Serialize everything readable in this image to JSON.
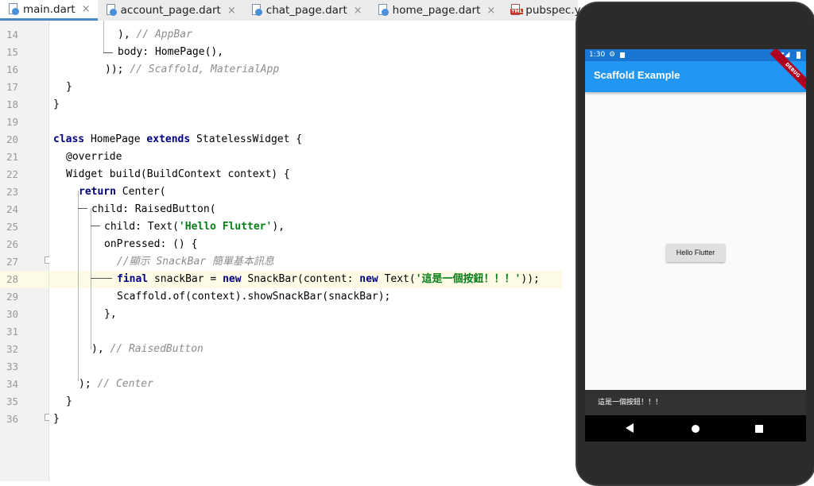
{
  "tabs": [
    {
      "label": "main.dart",
      "icon": "dart-file-icon",
      "active": true
    },
    {
      "label": "account_page.dart",
      "icon": "dart-file-icon",
      "active": false
    },
    {
      "label": "chat_page.dart",
      "icon": "dart-file-icon",
      "active": false
    },
    {
      "label": "home_page.dart",
      "icon": "dart-file-icon",
      "active": false
    },
    {
      "label": "pubspec.yaml",
      "icon": "yaml-file-icon",
      "active": false
    }
  ],
  "close_glyph": "×",
  "editor": {
    "highlight_line": "28",
    "lines": [
      {
        "num": "14"
      },
      {
        "num": "15"
      },
      {
        "num": "16"
      },
      {
        "num": "17"
      },
      {
        "num": "18"
      },
      {
        "num": "19"
      },
      {
        "num": "20"
      },
      {
        "num": "21"
      },
      {
        "num": "22"
      },
      {
        "num": "23"
      },
      {
        "num": "24"
      },
      {
        "num": "25"
      },
      {
        "num": "26"
      },
      {
        "num": "27"
      },
      {
        "num": "28"
      },
      {
        "num": "29"
      },
      {
        "num": "30"
      },
      {
        "num": "31"
      },
      {
        "num": "32"
      },
      {
        "num": "33"
      },
      {
        "num": "34"
      },
      {
        "num": "35"
      },
      {
        "num": "36"
      }
    ],
    "tokens": {
      "l14_a": "), ",
      "l14_c": "// AppBar",
      "l15_a": "body: HomePage(),",
      "l16_a": ")); ",
      "l16_c": "// Scaffold, MaterialApp",
      "l17_a": "}",
      "l18_a": "}",
      "l20_k1": "class",
      "l20_a": " HomePage ",
      "l20_k2": "extends",
      "l20_b": " StatelessWidget {",
      "l21_a": "@override",
      "l22_a": "Widget build(BuildContext context) {",
      "l23_k": "return",
      "l23_a": " Center(",
      "l24_a": "child: RaisedButton(",
      "l25_a": "child: Text(",
      "l25_s": "'Hello Flutter'",
      "l25_b": "),",
      "l26_a": "onPressed: () {",
      "l27_c": "//顯示 SnackBar 簡單基本訊息",
      "l28_k1": "final",
      "l28_a": " snackBar = ",
      "l28_k2": "new",
      "l28_b": " SnackBar(content: ",
      "l28_k3": "new",
      "l28_c": " Text(",
      "l28_s": "'這是一個按鈕！！！'",
      "l28_d": "));",
      "l29_a": "Scaffold.of(context).showSnackBar(snackBar);",
      "l30_a": "},",
      "l32_a": "), ",
      "l32_c": "// RaisedButton",
      "l34_a": "); ",
      "l34_c": "// Center",
      "l35_a": "}",
      "l36_a": "}"
    }
  },
  "phone": {
    "status_time": "1:30",
    "appbar_title": "Scaffold Example",
    "debug_banner": "DEBUG",
    "button_label": "Hello Flutter",
    "snackbar_text": "這是一個按鈕！！！",
    "colors": {
      "appbar": "#2196f3",
      "statusbar": "#1976d2",
      "snackbar": "#323232"
    }
  }
}
